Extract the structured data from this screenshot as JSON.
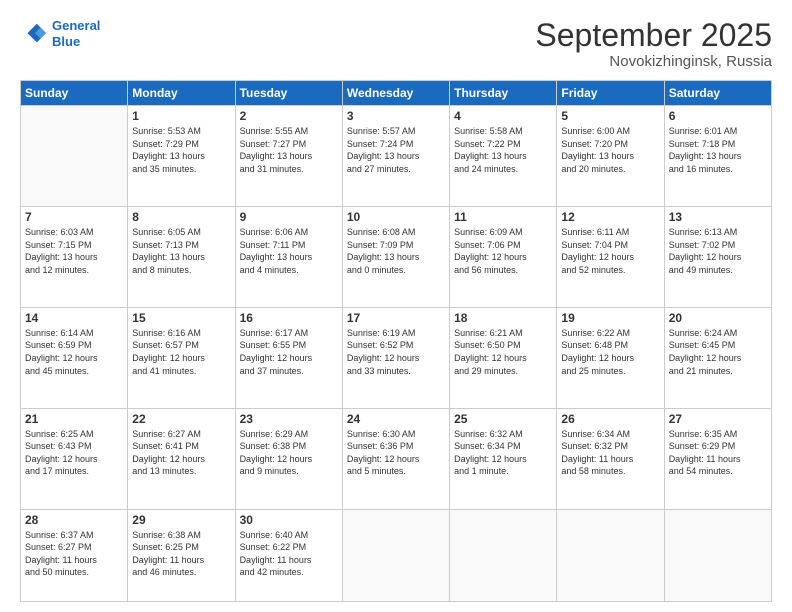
{
  "header": {
    "logo_line1": "General",
    "logo_line2": "Blue",
    "month": "September 2025",
    "location": "Novokizhinginsk, Russia"
  },
  "weekdays": [
    "Sunday",
    "Monday",
    "Tuesday",
    "Wednesday",
    "Thursday",
    "Friday",
    "Saturday"
  ],
  "weeks": [
    [
      {
        "day": "",
        "info": ""
      },
      {
        "day": "1",
        "info": "Sunrise: 5:53 AM\nSunset: 7:29 PM\nDaylight: 13 hours\nand 35 minutes."
      },
      {
        "day": "2",
        "info": "Sunrise: 5:55 AM\nSunset: 7:27 PM\nDaylight: 13 hours\nand 31 minutes."
      },
      {
        "day": "3",
        "info": "Sunrise: 5:57 AM\nSunset: 7:24 PM\nDaylight: 13 hours\nand 27 minutes."
      },
      {
        "day": "4",
        "info": "Sunrise: 5:58 AM\nSunset: 7:22 PM\nDaylight: 13 hours\nand 24 minutes."
      },
      {
        "day": "5",
        "info": "Sunrise: 6:00 AM\nSunset: 7:20 PM\nDaylight: 13 hours\nand 20 minutes."
      },
      {
        "day": "6",
        "info": "Sunrise: 6:01 AM\nSunset: 7:18 PM\nDaylight: 13 hours\nand 16 minutes."
      }
    ],
    [
      {
        "day": "7",
        "info": "Sunrise: 6:03 AM\nSunset: 7:15 PM\nDaylight: 13 hours\nand 12 minutes."
      },
      {
        "day": "8",
        "info": "Sunrise: 6:05 AM\nSunset: 7:13 PM\nDaylight: 13 hours\nand 8 minutes."
      },
      {
        "day": "9",
        "info": "Sunrise: 6:06 AM\nSunset: 7:11 PM\nDaylight: 13 hours\nand 4 minutes."
      },
      {
        "day": "10",
        "info": "Sunrise: 6:08 AM\nSunset: 7:09 PM\nDaylight: 13 hours\nand 0 minutes."
      },
      {
        "day": "11",
        "info": "Sunrise: 6:09 AM\nSunset: 7:06 PM\nDaylight: 12 hours\nand 56 minutes."
      },
      {
        "day": "12",
        "info": "Sunrise: 6:11 AM\nSunset: 7:04 PM\nDaylight: 12 hours\nand 52 minutes."
      },
      {
        "day": "13",
        "info": "Sunrise: 6:13 AM\nSunset: 7:02 PM\nDaylight: 12 hours\nand 49 minutes."
      }
    ],
    [
      {
        "day": "14",
        "info": "Sunrise: 6:14 AM\nSunset: 6:59 PM\nDaylight: 12 hours\nand 45 minutes."
      },
      {
        "day": "15",
        "info": "Sunrise: 6:16 AM\nSunset: 6:57 PM\nDaylight: 12 hours\nand 41 minutes."
      },
      {
        "day": "16",
        "info": "Sunrise: 6:17 AM\nSunset: 6:55 PM\nDaylight: 12 hours\nand 37 minutes."
      },
      {
        "day": "17",
        "info": "Sunrise: 6:19 AM\nSunset: 6:52 PM\nDaylight: 12 hours\nand 33 minutes."
      },
      {
        "day": "18",
        "info": "Sunrise: 6:21 AM\nSunset: 6:50 PM\nDaylight: 12 hours\nand 29 minutes."
      },
      {
        "day": "19",
        "info": "Sunrise: 6:22 AM\nSunset: 6:48 PM\nDaylight: 12 hours\nand 25 minutes."
      },
      {
        "day": "20",
        "info": "Sunrise: 6:24 AM\nSunset: 6:45 PM\nDaylight: 12 hours\nand 21 minutes."
      }
    ],
    [
      {
        "day": "21",
        "info": "Sunrise: 6:25 AM\nSunset: 6:43 PM\nDaylight: 12 hours\nand 17 minutes."
      },
      {
        "day": "22",
        "info": "Sunrise: 6:27 AM\nSunset: 6:41 PM\nDaylight: 12 hours\nand 13 minutes."
      },
      {
        "day": "23",
        "info": "Sunrise: 6:29 AM\nSunset: 6:38 PM\nDaylight: 12 hours\nand 9 minutes."
      },
      {
        "day": "24",
        "info": "Sunrise: 6:30 AM\nSunset: 6:36 PM\nDaylight: 12 hours\nand 5 minutes."
      },
      {
        "day": "25",
        "info": "Sunrise: 6:32 AM\nSunset: 6:34 PM\nDaylight: 12 hours\nand 1 minute."
      },
      {
        "day": "26",
        "info": "Sunrise: 6:34 AM\nSunset: 6:32 PM\nDaylight: 11 hours\nand 58 minutes."
      },
      {
        "day": "27",
        "info": "Sunrise: 6:35 AM\nSunset: 6:29 PM\nDaylight: 11 hours\nand 54 minutes."
      }
    ],
    [
      {
        "day": "28",
        "info": "Sunrise: 6:37 AM\nSunset: 6:27 PM\nDaylight: 11 hours\nand 50 minutes."
      },
      {
        "day": "29",
        "info": "Sunrise: 6:38 AM\nSunset: 6:25 PM\nDaylight: 11 hours\nand 46 minutes."
      },
      {
        "day": "30",
        "info": "Sunrise: 6:40 AM\nSunset: 6:22 PM\nDaylight: 11 hours\nand 42 minutes."
      },
      {
        "day": "",
        "info": ""
      },
      {
        "day": "",
        "info": ""
      },
      {
        "day": "",
        "info": ""
      },
      {
        "day": "",
        "info": ""
      }
    ]
  ]
}
